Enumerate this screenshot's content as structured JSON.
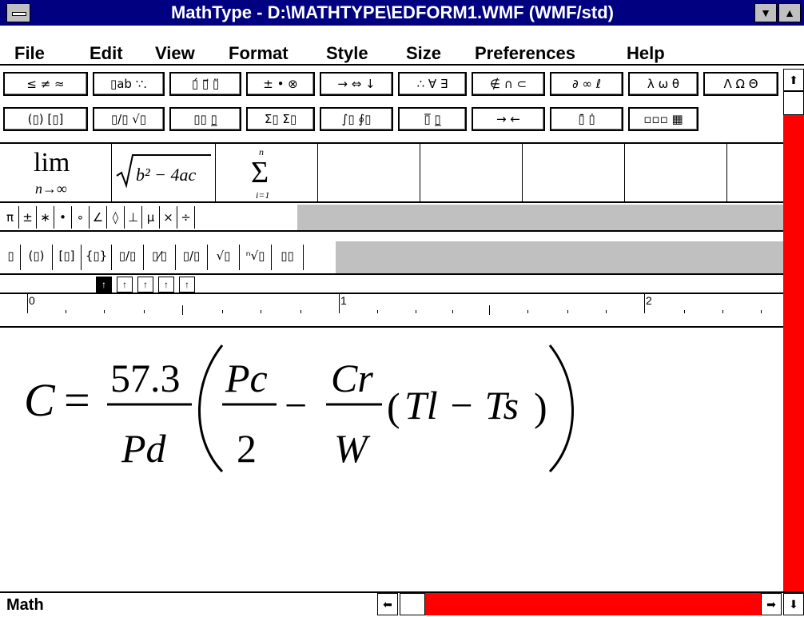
{
  "window": {
    "title": "MathType - D:\\MATHTYPE\\EDFORM1.WMF (WMF/std)"
  },
  "menu": {
    "file": "File",
    "edit": "Edit",
    "view": "View",
    "format": "Format",
    "style": "Style",
    "size": "Size",
    "preferences": "Preferences",
    "help": "Help"
  },
  "palette_row1": [
    "≤ ≠ ≈",
    "▯ab ∵.",
    "▯́ ▯⃗ ▯̈",
    "± • ⊗",
    "→ ⇔ ↓",
    "∴ ∀ ∃",
    "∉ ∩ ⊂",
    "∂ ∞ ℓ",
    "λ ω θ",
    "Λ Ω Θ"
  ],
  "palette_row2": [
    "(▯) [▯]",
    "▯/▯ √▯",
    "▯▯ ▯̲",
    "Σ▯ Σ▯",
    "∫▯ ∮▯",
    "▯̅ ▯̲",
    "→ ←",
    "▯̄ ▯̇",
    "▫▫▫ ▦"
  ],
  "templates": {
    "lim_top": "lim",
    "lim_sub": "n→∞",
    "sqrt_expr": "b² − 4ac",
    "sum_top": "n",
    "sum_symbol": "Σ",
    "sum_bottom": "i=1"
  },
  "symbols": [
    "π",
    "±",
    "∗",
    "•",
    "∘",
    "∠",
    "◊",
    "⊥",
    "µ",
    "×",
    "÷"
  ],
  "small_templates": [
    "▯",
    "(▯)",
    "[▯]",
    "{▯}",
    "▯/▯",
    "▯⁄▯",
    "▯/▯",
    "√▯",
    "ⁿ√▯",
    "▯▯"
  ],
  "tabs": [
    "↑",
    "↑",
    "↑",
    "↑",
    "↑"
  ],
  "ruler": {
    "label_0": "0",
    "label_1": "1",
    "label_2": "2"
  },
  "equation": {
    "lhs": "C",
    "equals": "=",
    "frac1_num": "57.3",
    "frac1_den": "Pd",
    "frac2_num": "Pc",
    "frac2_den": "2",
    "minus": "−",
    "frac3_num": "Cr",
    "frac3_den": "W",
    "paren_inner": "Tl − Ts"
  },
  "status": {
    "style": "Math"
  },
  "colors": {
    "titlebar": "#000080",
    "scrollbar": "#ff0000",
    "chrome": "#c0c0c0"
  }
}
